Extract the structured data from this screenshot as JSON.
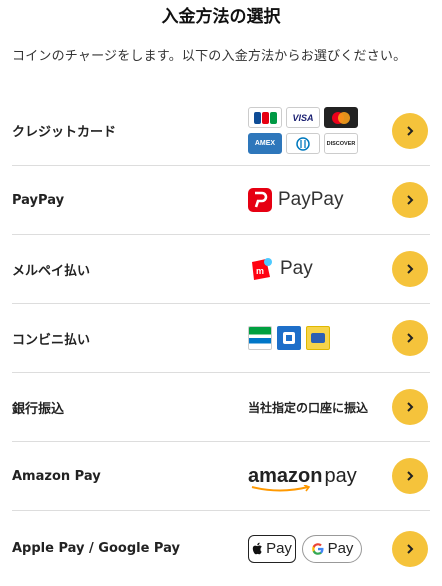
{
  "header": {
    "title": "入金方法の選択",
    "intro": "コインのチャージをします。以下の入金方法からお選びください。"
  },
  "methods": [
    {
      "label": "クレジットカード",
      "logo": "card-brands"
    },
    {
      "label": "PayPay",
      "logo": "paypay"
    },
    {
      "label": "メルペイ払い",
      "logo": "merpay"
    },
    {
      "label": "コンビニ払い",
      "logo": "konbini"
    },
    {
      "label": "銀行振込",
      "logo": "bank-transfer"
    },
    {
      "label": "Amazon Pay",
      "logo": "amazon-pay"
    },
    {
      "label": "Apple Pay / Google Pay",
      "logo": "wallets"
    }
  ],
  "logos": {
    "card_brands": {
      "jcb": "JCB",
      "visa": "VISA",
      "amex": "AMEX",
      "discover": "DISCOVER"
    },
    "paypay_text": "PayPay",
    "merpay_text": "Pay",
    "bank_note": "当社指定の口座に振込",
    "amazon_word": "amazon",
    "amazon_pay": "pay",
    "apple_pay": "Pay",
    "google_pay": "Pay"
  },
  "colors": {
    "accent": "#f5c33b",
    "paypay_red": "#e60012",
    "merpay_red": "#ff0211",
    "divider": "#dddddd"
  },
  "icons": {
    "row_action": "chevron-right-icon"
  }
}
